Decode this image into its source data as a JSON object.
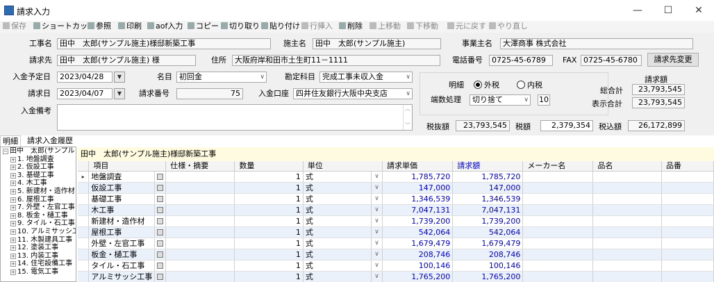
{
  "window": {
    "title": "請求入力",
    "minimize": "—",
    "maximize": "☐",
    "close": "✕"
  },
  "toolbar": [
    {
      "label": "保存",
      "enabled": false
    },
    {
      "label": "ショートカット",
      "enabled": true
    },
    {
      "label": "参照",
      "enabled": true
    },
    {
      "label": "印刷",
      "enabled": true
    },
    {
      "label": "aof入力",
      "enabled": true
    },
    {
      "label": "コピー",
      "enabled": true
    },
    {
      "label": "切り取り",
      "enabled": true
    },
    {
      "label": "貼り付け",
      "enabled": true
    },
    {
      "label": "行挿入",
      "enabled": false
    },
    {
      "label": "削除",
      "enabled": true
    },
    {
      "label": "上移動",
      "enabled": false
    },
    {
      "label": "下移動",
      "enabled": false
    },
    {
      "label": "元に戻す",
      "enabled": false
    },
    {
      "label": "やり直し",
      "enabled": false
    }
  ],
  "form": {
    "koji_label": "工事名",
    "koji_value": "田中　太郎(サンプル施主)様邸新築工事",
    "seshu_label": "施主名",
    "seshu_value": "田中　太郎(サンプル施主)",
    "jigyo_label": "事業主名",
    "jigyo_value": "大澤商事 株式会社",
    "seikyusaki_label": "請求先",
    "seikyusaki_value": "田中　太郎(サンプル施主) 様",
    "jusho_label": "住所",
    "jusho_value": "大阪府岸和田市土生町11－1111",
    "tel_label": "電話番号",
    "tel_value": "0725-45-6789",
    "fax_label": "FAX",
    "fax_value": "0725-45-6780",
    "change_btn": "請求先変更",
    "nyukin_yotei_label": "入金予定日",
    "nyukin_yotei_value": "2023/04/28",
    "meimoku_label": "名目",
    "meimoku_value": "初回金",
    "kanjo_label": "勘定科目",
    "kanjo_value": "完成工事未収入金",
    "seikyubi_label": "請求日",
    "seikyubi_value": "2023/04/07",
    "seikyu_no_label": "請求番号",
    "seikyu_no_value": "75",
    "koza_label": "入金口座",
    "koza_value": "四井住友銀行大阪中央支店",
    "biko_label": "入金備考",
    "biko_value": "",
    "meisai_label": "明細",
    "gaizei": "外税",
    "naizei": "内税",
    "hasu_label": "端数処理",
    "hasu_value": "切り捨て",
    "hasu_digits": "10",
    "seikyugaku_label": "請求額",
    "sogokei_label": "総合計",
    "sogokei_value": "23,793,545",
    "hyoji_label": "表示合計",
    "hyoji_value": "23,793,545",
    "zeinuki_label": "税抜額",
    "zeinuki_value": "23,793,545",
    "zeigaku_label": "税額",
    "zeigaku_value": "2,379,354",
    "zeikomi_label": "税込額",
    "zeikomi_value": "26,172,899"
  },
  "tabs": [
    "明細",
    "請求入金履歴"
  ],
  "tree": {
    "root": "田中　太郎(サンプル",
    "items": [
      "1. 地盤調査",
      "2. 仮設工事",
      "3. 基礎工事",
      "4. 木工事",
      "5. 新建材・造作材",
      "6. 屋根工事",
      "7. 外壁・左官工事",
      "8. 板金・樋工事",
      "9. タイル・石工事",
      "10. アルミサッシ工",
      "11. 木製建具工事",
      "12. 塗装工事",
      "13. 内装工事",
      "14. 住宅設備工事",
      "15. 電気工事"
    ]
  },
  "detail_header": "田中　太郎(サンプル施主)様邸新築工事",
  "grid": {
    "columns": [
      "項目",
      "仕様・摘要",
      "数量",
      "単位",
      "請求単価",
      "請求額",
      "メーカー名",
      "品名",
      "品番"
    ],
    "rows": [
      {
        "item": "地盤調査",
        "qty": "1",
        "unit": "式",
        "price": "1,785,720",
        "amount": "1,785,720"
      },
      {
        "item": "仮設工事",
        "qty": "1",
        "unit": "式",
        "price": "147,000",
        "amount": "147,000"
      },
      {
        "item": "基礎工事",
        "qty": "1",
        "unit": "式",
        "price": "1,346,539",
        "amount": "1,346,539"
      },
      {
        "item": "木工事",
        "qty": "1",
        "unit": "式",
        "price": "7,047,131",
        "amount": "7,047,131"
      },
      {
        "item": "新建材・造作材",
        "qty": "1",
        "unit": "式",
        "price": "1,739,200",
        "amount": "1,739,200"
      },
      {
        "item": "屋根工事",
        "qty": "1",
        "unit": "式",
        "price": "542,064",
        "amount": "542,064"
      },
      {
        "item": "外壁・左官工事",
        "qty": "1",
        "unit": "式",
        "price": "1,679,479",
        "amount": "1,679,479"
      },
      {
        "item": "板金・樋工事",
        "qty": "1",
        "unit": "式",
        "price": "208,746",
        "amount": "208,746"
      },
      {
        "item": "タイル・石工事",
        "qty": "1",
        "unit": "式",
        "price": "100,146",
        "amount": "100,146"
      },
      {
        "item": "アルミサッシ工事",
        "qty": "1",
        "unit": "式",
        "price": "1,765,200",
        "amount": "1,765,200"
      }
    ]
  }
}
